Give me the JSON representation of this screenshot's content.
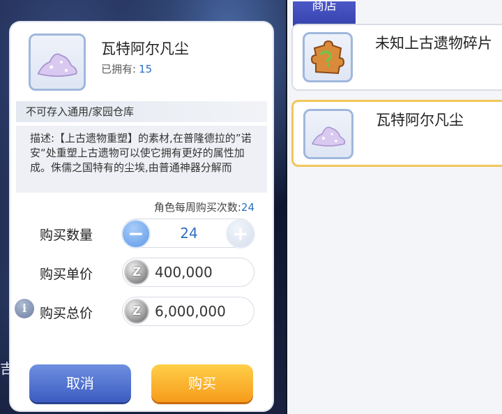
{
  "shop": {
    "tag_label": "商店",
    "items": [
      {
        "name": "未知上古遗物碎片",
        "icon": "puzzle-piece-icon",
        "selected": false
      },
      {
        "name": "瓦特阿尔凡尘",
        "icon": "dust-pile-icon",
        "selected": true
      }
    ]
  },
  "background": {
    "partial_text": "吉"
  },
  "dialog": {
    "item_name": "瓦特阿尔凡尘",
    "owned_label": "已拥有:",
    "owned_count": "15",
    "restriction": "不可存入通用/家园仓库",
    "description": "描述:【上古遗物重塑】的素材,在普隆德拉的”诺安“处重塑上古遗物可以使它拥有更好的属性加成。侏儒之国特有的尘埃,由普通神器分解而",
    "weekly_label": "角色每周购买次数:",
    "weekly_count": "24",
    "quantity": {
      "label": "购买数量",
      "value": "24"
    },
    "unit_price": {
      "label": "购买单价",
      "value": "400,000"
    },
    "total_price": {
      "label": "购买总价",
      "value": "6,000,000"
    },
    "coin_glyph": "Z",
    "info_glyph": "i",
    "cancel_label": "取消",
    "buy_label": "购买"
  },
  "colors": {
    "accent_blue": "#2c6ec4",
    "cancel_button": "#3d5cc2",
    "buy_button": "#f69b1b",
    "selected_border": "#f2c65a"
  }
}
